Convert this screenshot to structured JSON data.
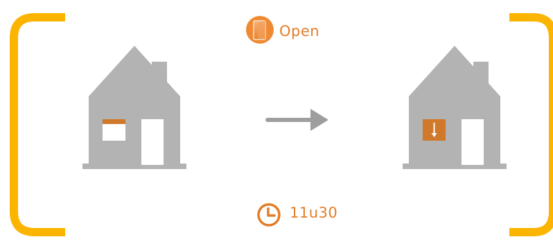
{
  "status": {
    "label": "Open",
    "icon": "door-open-icon"
  },
  "schedule": {
    "time": "11u30",
    "icon": "clock-icon"
  },
  "scene": {
    "before_icon": "house-window-icon",
    "transition_icon": "arrow-right-icon",
    "after_icon": "house-shutter-closed-icon"
  },
  "colors": {
    "bracket": "#fbb400",
    "house": "#b3b3b3",
    "accent": "#d0792b",
    "arrow": "#9e9e9e",
    "text": "#e37d27"
  }
}
